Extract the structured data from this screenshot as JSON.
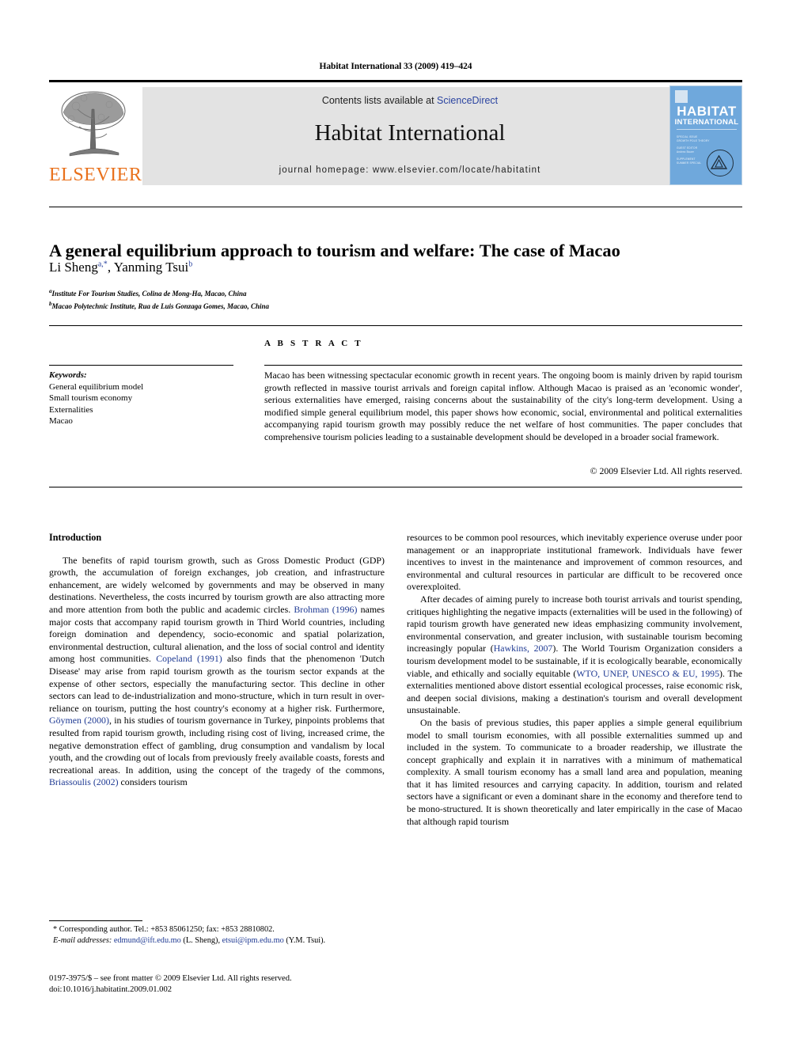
{
  "running_head": "Habitat International 33 (2009) 419–424",
  "masthead": {
    "publisher_name": "ELSEVIER",
    "contents_text": "Contents lists available at ",
    "contents_link": "ScienceDirect",
    "journal_name": "Habitat International",
    "homepage_text": "journal homepage: www.elsevier.com/locate/habitatint",
    "cover": {
      "title_line1": "HABITAT",
      "title_line2": "INTERNATIONAL",
      "micro_lines": [
        "SPECIAL ISSUE",
        "GROWTH POLE THEORY",
        "GUEST EDITOR",
        "Andrea Bauer",
        "SUPPLEMENT",
        "SUMMER SPECIAL"
      ]
    }
  },
  "article": {
    "title": "A general equilibrium approach to tourism and welfare: The case of Macao",
    "authors": [
      {
        "name": "Li Sheng",
        "marks": "a,*"
      },
      {
        "name": "Yanming Tsui",
        "marks": "b"
      }
    ],
    "affiliations": [
      {
        "mark": "a",
        "text": "Institute For Tourism Studies, Colina de Mong-Ha, Macao, China"
      },
      {
        "mark": "b",
        "text": "Macao Polytechnic Institute, Rua de Luis Gonzaga Gomes, Macao, China"
      }
    ]
  },
  "abstract": {
    "heading": "A B S T R A C T",
    "text": "Macao has been witnessing spectacular economic growth in recent years. The ongoing boom is mainly driven by rapid tourism growth reflected in massive tourist arrivals and foreign capital inflow. Although Macao is praised as an 'economic wonder', serious externalities have emerged, raising concerns about the sustainability of the city's long-term development. Using a modified simple general equilibrium model, this paper shows how economic, social, environmental and political externalities accompanying rapid tourism growth may possibly reduce the net welfare of host communities. The paper concludes that comprehensive tourism policies leading to a sustainable development should be developed in a broader social framework.",
    "copyright": "© 2009 Elsevier Ltd. All rights reserved."
  },
  "keywords": {
    "label": "Keywords:",
    "items": [
      "General equilibrium model",
      "Small tourism economy",
      "Externalities",
      "Macao"
    ]
  },
  "body": {
    "section_heading": "Introduction",
    "left_column": [
      "The benefits of rapid tourism growth, such as Gross Domestic Product (GDP) growth, the accumulation of foreign exchanges, job creation, and infrastructure enhancement, are widely welcomed by governments and may be observed in many destinations. Nevertheless, the costs incurred by tourism growth are also attracting more and more attention from both the public and academic circles. Brohman (1996) names major costs that accompany rapid tourism growth in Third World countries, including foreign domination and dependency, socio-economic and spatial polarization, environmental destruction, cultural alienation, and the loss of social control and identity among host communities. Copeland (1991) also finds that the phenomenon 'Dutch Disease' may arise from rapid tourism growth as the tourism sector expands at the expense of other sectors, especially the manufacturing sector. This decline in other sectors can lead to de-industrialization and mono-structure, which in turn result in over-reliance on tourism, putting the host country's economy at a higher risk. Furthermore, Göymen (2000), in his studies of tourism governance in Turkey, pinpoints problems that resulted from rapid tourism growth, including rising cost of living, increased crime, the negative demonstration effect of gambling, drug consumption and vandalism by local youth, and the crowding out of locals from previously freely available coasts, forests and recreational areas. In addition, using the concept of the tragedy of the commons, Briassoulis (2002) considers tourism"
    ],
    "right_column": [
      "resources to be common pool resources, which inevitably experience overuse under poor management or an inappropriate institutional framework. Individuals have fewer incentives to invest in the maintenance and improvement of common resources, and environmental and cultural resources in particular are difficult to be recovered once overexploited.",
      "After decades of aiming purely to increase both tourist arrivals and tourist spending, critiques highlighting the negative impacts (externalities will be used in the following) of rapid tourism growth have generated new ideas emphasizing community involvement, environmental conservation, and greater inclusion, with sustainable tourism becoming increasingly popular (Hawkins, 2007). The World Tourism Organization considers a tourism development model to be sustainable, if it is ecologically bearable, economically viable, and ethically and socially equitable (WTO, UNEP, UNESCO & EU, 1995). The externalities mentioned above distort essential ecological processes, raise economic risk, and deepen social divisions, making a destination's tourism and overall development unsustainable.",
      "On the basis of previous studies, this paper applies a simple general equilibrium model to small tourism economies, with all possible externalities summed up and included in the system. To communicate to a broader readership, we illustrate the concept graphically and explain it in narratives with a minimum of mathematical complexity. A small tourism economy has a small land area and population, meaning that it has limited resources and carrying capacity. In addition, tourism and related sectors have a significant or even a dominant share in the economy and therefore tend to be mono-structured. It is shown theoretically and later empirically in the case of Macao that although rapid tourism"
    ]
  },
  "footnotes": {
    "corresponding": "* Corresponding author. Tel.: +853 85061250; fax: +853 28810802.",
    "email_label": "E-mail addresses:",
    "email_1": "edmund@ift.edu.mo",
    "email_1_owner": "(L. Sheng),",
    "email_2": "etsui@ipm.edu.mo",
    "email_2_owner": "(Y.M. Tsui)."
  },
  "imprint": {
    "line1": "0197-3975/$ – see front matter © 2009 Elsevier Ltd. All rights reserved.",
    "line2": "doi:10.1016/j.habitatint.2009.01.002"
  }
}
